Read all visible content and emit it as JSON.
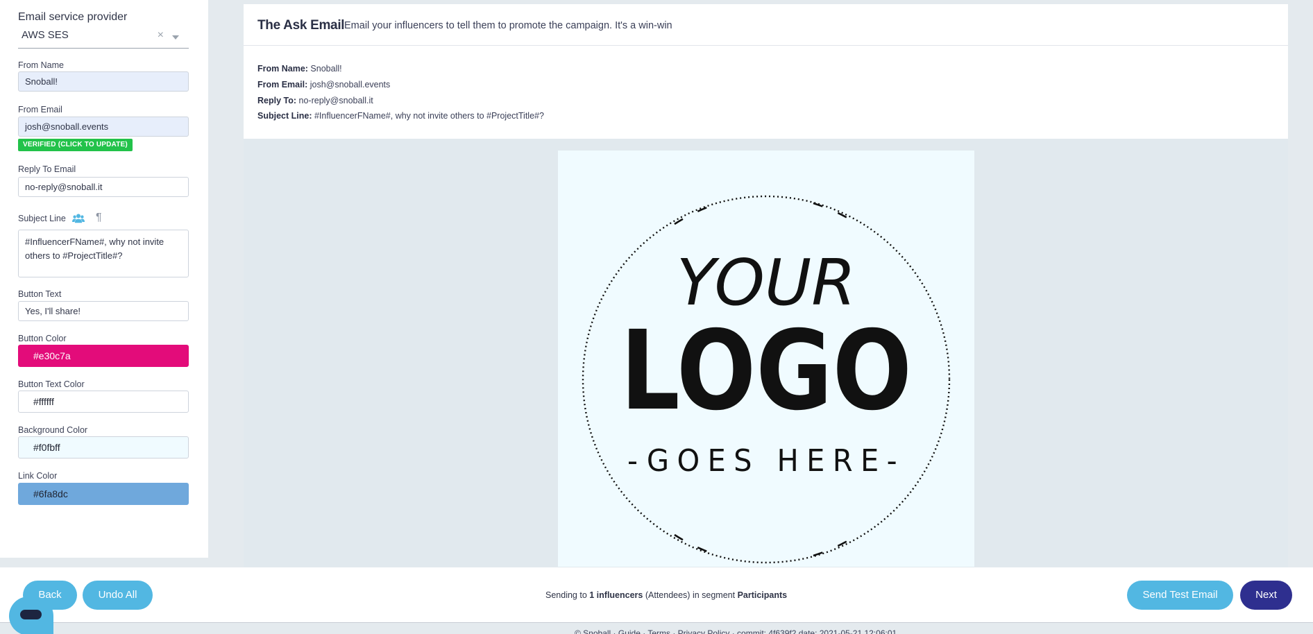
{
  "settings": {
    "provider": {
      "label": "Email service provider",
      "value": "AWS SES",
      "clear": "×"
    },
    "from_name": {
      "label": "From Name",
      "value": "Snoball!"
    },
    "from_email": {
      "label": "From Email",
      "value": "josh@snoball.events",
      "badge": "VERIFIED (CLICK TO UPDATE)"
    },
    "reply_to": {
      "label": "Reply To Email",
      "value": "no-reply@snoball.it"
    },
    "subject": {
      "label": "Subject Line",
      "value": "#InfluencerFName#, why not invite others to #ProjectTitle#?",
      "pilcrow": "¶"
    },
    "button_text": {
      "label": "Button Text",
      "value": "Yes, I'll share!"
    },
    "button_color": {
      "label": "Button Color",
      "value": "#e30c7a"
    },
    "button_text_color": {
      "label": "Button Text Color",
      "value": "#ffffff"
    },
    "background_color": {
      "label": "Background Color",
      "value": "#f0fbff"
    },
    "link_color": {
      "label": "Link Color",
      "value": "#6fa8dc"
    }
  },
  "card": {
    "title": "The Ask Email",
    "subtitle": "Email your influencers to tell them to promote the campaign. It's a win-win",
    "from_name": {
      "label": "From Name:",
      "value": "Snoball!"
    },
    "from_email": {
      "label": "From Email:",
      "value": "josh@snoball.events"
    },
    "reply_to": {
      "label": "Reply To:",
      "value": "no-reply@snoball.it"
    },
    "subject": {
      "label": "Subject Line:",
      "value": "#InfluencerFName#, why not invite others to #ProjectTitle#?"
    }
  },
  "preview": {
    "logo_line1": "YOUR",
    "logo_line2": "LOGO",
    "logo_line3": "-GOES HERE-"
  },
  "bottom": {
    "back": "Back",
    "undo_all": "Undo All",
    "sending_prefix": "Sending to ",
    "count": "1 influencers",
    "audience": " (Attendees) in segment ",
    "segment": "Participants",
    "send_test": "Send Test Email",
    "next": "Next",
    "footer": "© Snoball · Guide · Terms · Privacy Policy · commit: 4f639f2 date: 2021-05-21 12:06:01"
  },
  "colors": {
    "accent": "#52b7e2",
    "primary": "#2e2f8f",
    "verified": "#22c24a"
  }
}
